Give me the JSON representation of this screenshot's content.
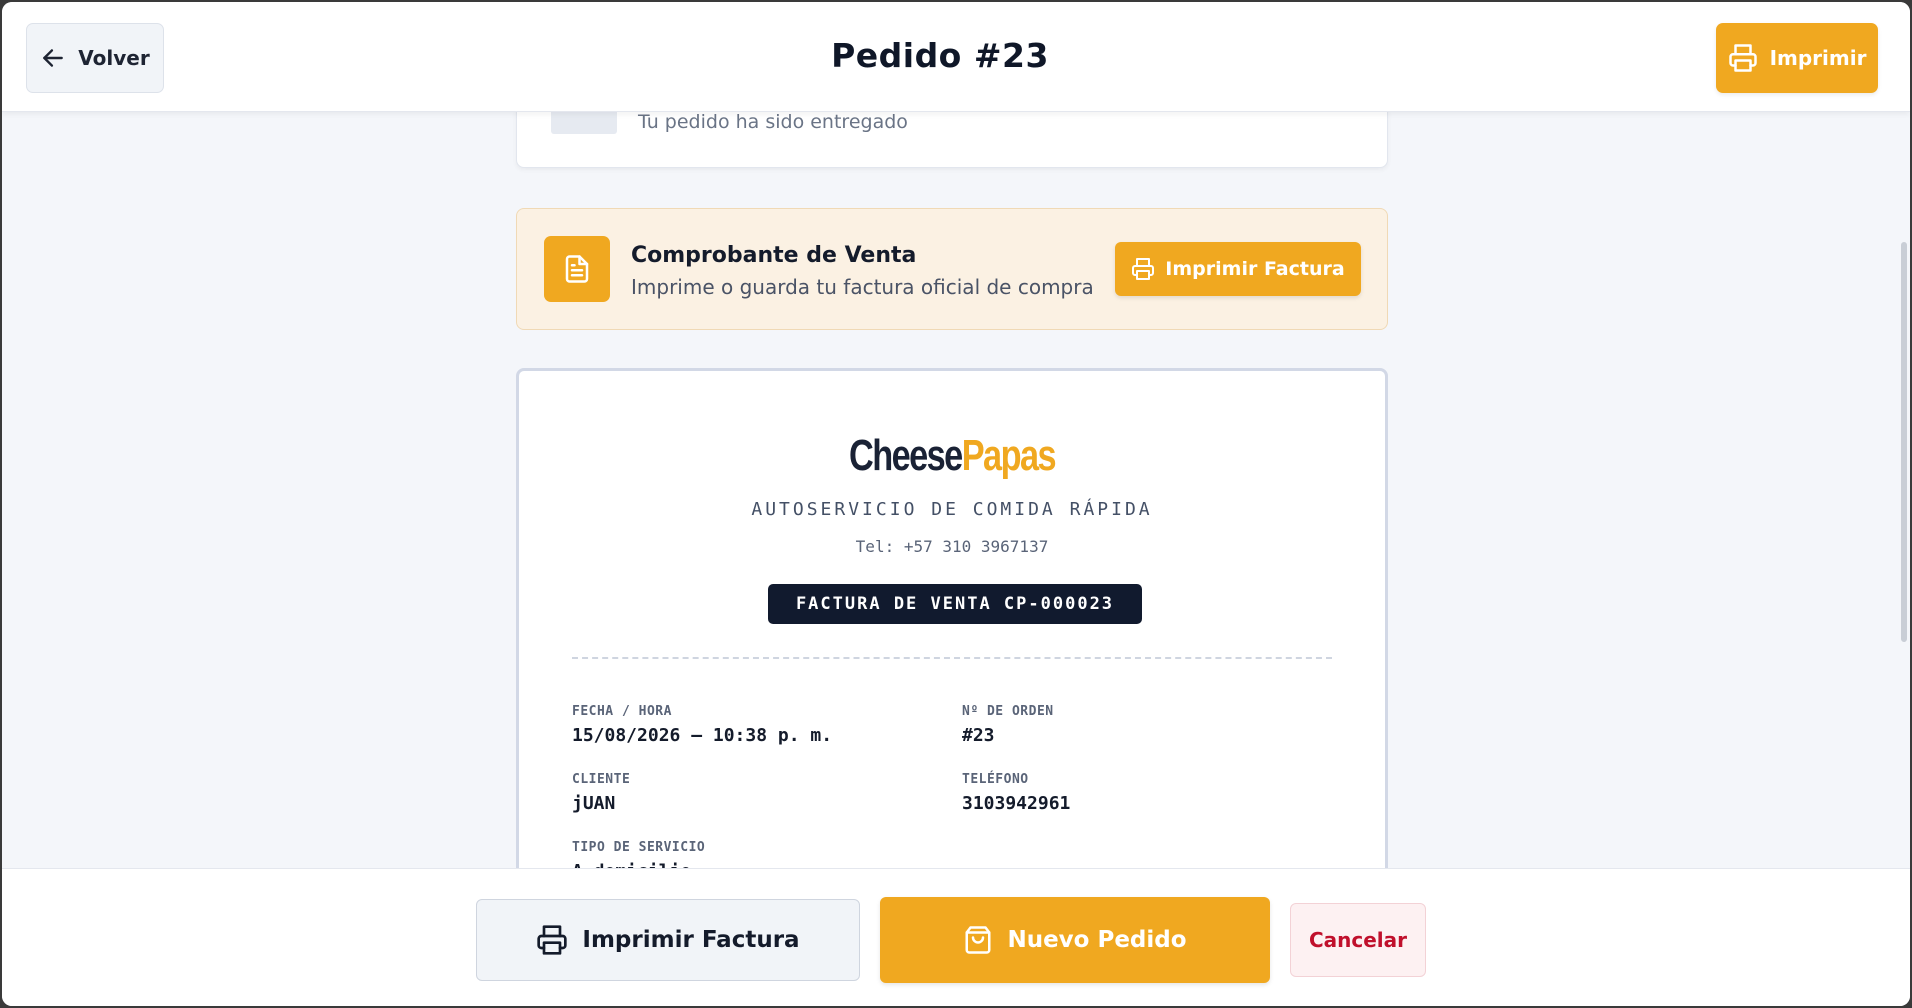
{
  "header": {
    "back_label": "Volver",
    "title": "Pedido #23",
    "print_label": "Imprimir"
  },
  "status": {
    "message": "Tu pedido ha sido entregado"
  },
  "voucher": {
    "title": "Comprobante de Venta",
    "subtitle": "Imprime o guarda tu factura oficial de compra",
    "button_label": "Imprimir Factura"
  },
  "invoice": {
    "brand_part1": "Cheese",
    "brand_part2": "Papas",
    "tagline": "AUTOSERVICIO DE COMIDA RÁPIDA",
    "phone": "Tel: +57 310 3967137",
    "number_label": "FACTURA DE VENTA CP-000023",
    "fields": [
      {
        "label": "FECHA / HORA",
        "value": "15/08/2026 — 10:38 p. m."
      },
      {
        "label": "Nº DE ORDEN",
        "value": "#23"
      },
      {
        "label": "CLIENTE",
        "value": "jUAN"
      },
      {
        "label": "TELÉFONO",
        "value": "3103942961"
      },
      {
        "label": "TIPO DE SERVICIO",
        "value": "A domicilio"
      }
    ]
  },
  "footer": {
    "print_label": "Imprimir Factura",
    "new_order_label": "Nuevo Pedido",
    "cancel_label": "Cancelar"
  },
  "colors": {
    "accent": "#f0a820",
    "dark": "#111a2e",
    "danger": "#c0102c"
  }
}
